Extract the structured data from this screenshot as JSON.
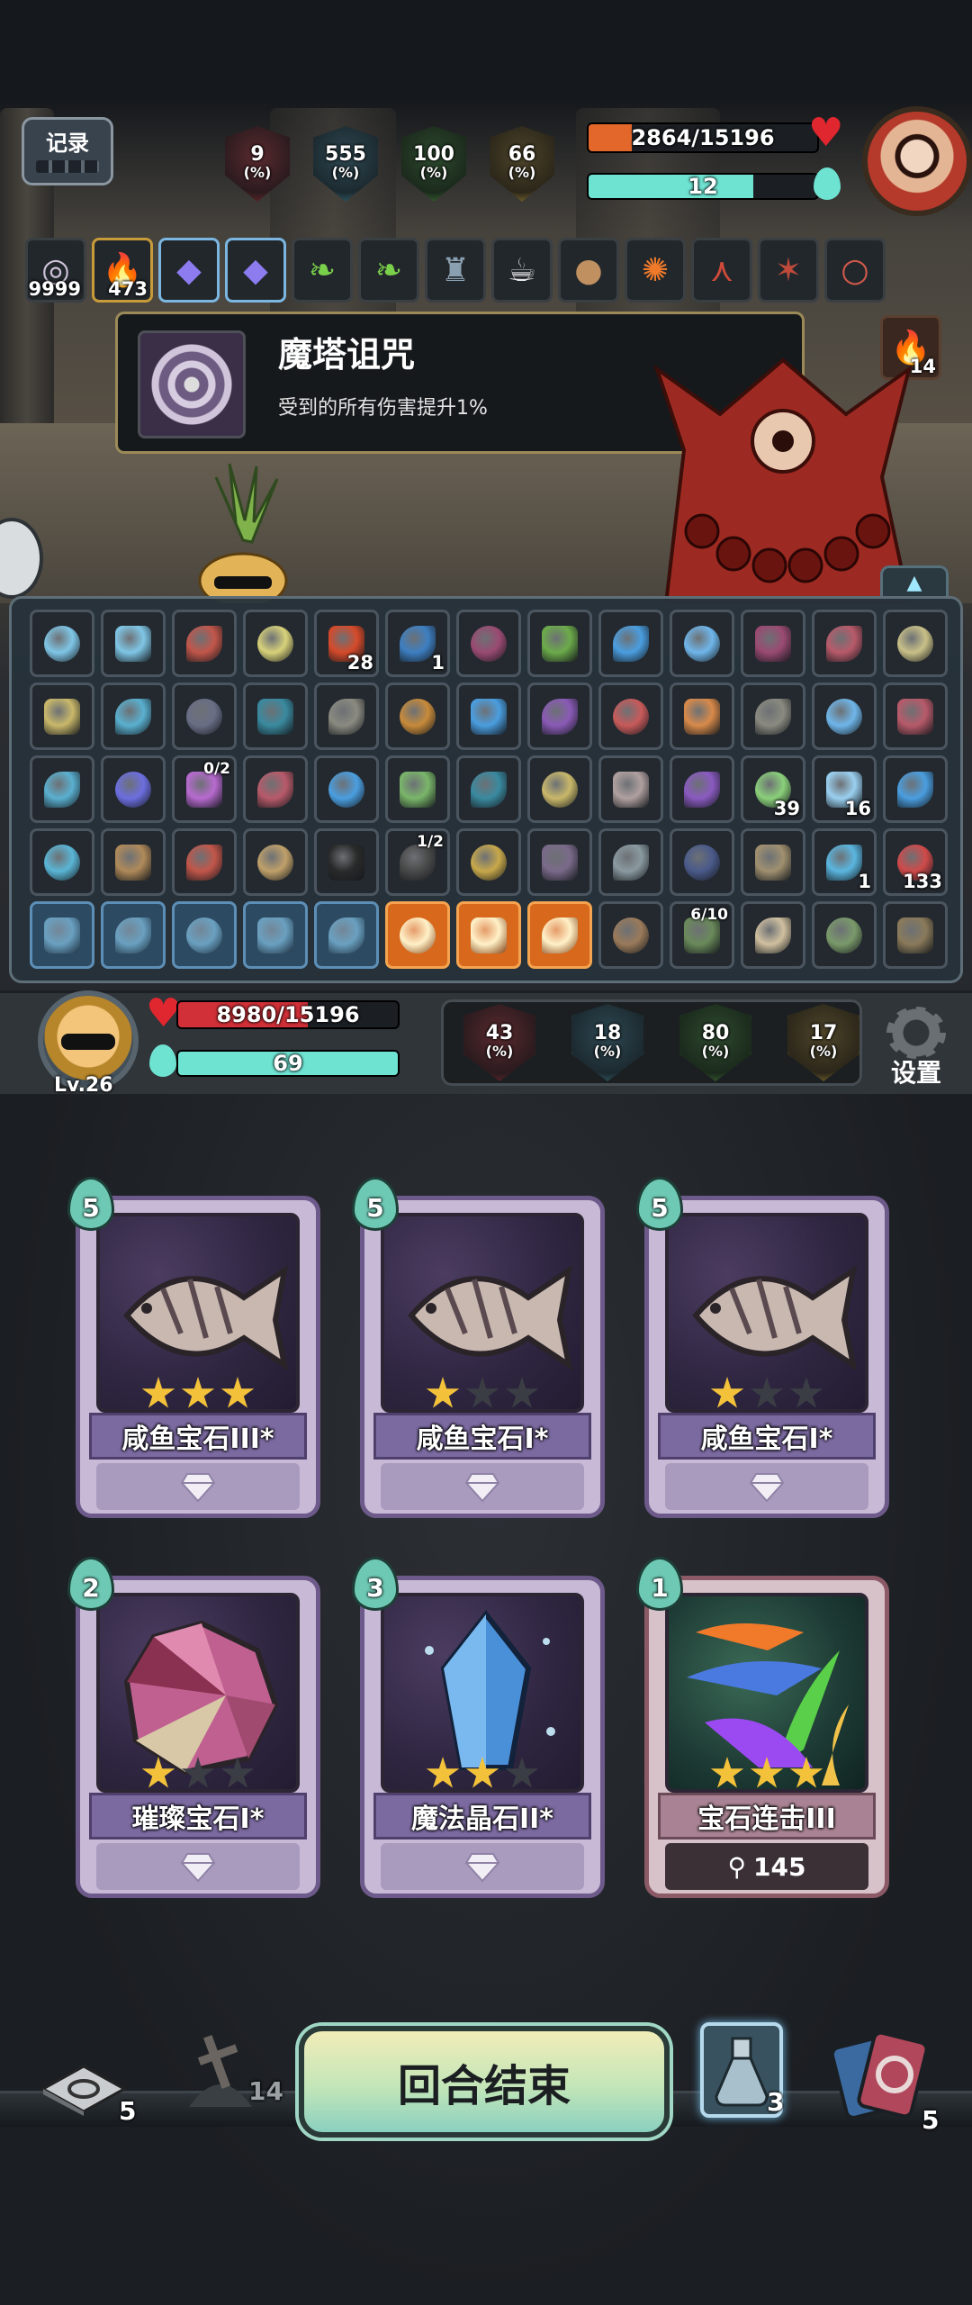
{
  "record_label": "记录",
  "enemy": {
    "stats": [
      {
        "value": "9",
        "unit": "(%)",
        "style": "sh-red"
      },
      {
        "value": "555",
        "unit": "(%)",
        "style": "sh-blue"
      },
      {
        "value": "100",
        "unit": "(%)",
        "style": "sh-green"
      },
      {
        "value": "66",
        "unit": "(%)",
        "style": "sh-gold"
      }
    ],
    "hp_text": "2864/15196",
    "hp_fraction": 0.188,
    "energy_text": "12",
    "energy_fraction": 0.72,
    "fire_count": "14"
  },
  "buffs": [
    {
      "icon": "spiral-curse-icon",
      "glyph": "◎",
      "count": "9999",
      "border": "normal"
    },
    {
      "icon": "golden-fire-icon",
      "glyph": "🔥",
      "count": "473",
      "border": "gold"
    },
    {
      "icon": "purple-gem-icon",
      "glyph": "◆",
      "count": "",
      "border": "blue"
    },
    {
      "icon": "purple-gem-icon",
      "glyph": "◆",
      "count": "",
      "border": "blue"
    },
    {
      "icon": "green-leaf-icon",
      "glyph": "❧",
      "count": "",
      "border": "normal"
    },
    {
      "icon": "green-leaf-icon",
      "glyph": "❧",
      "count": "",
      "border": "normal"
    },
    {
      "icon": "armor-figure-icon",
      "glyph": "♜",
      "count": "",
      "border": "normal"
    },
    {
      "icon": "teacup-icon",
      "glyph": "☕",
      "count": "",
      "border": "normal"
    },
    {
      "icon": "cookie-icon",
      "glyph": "●",
      "count": "",
      "border": "normal"
    },
    {
      "icon": "flame-dragon-icon",
      "glyph": "✺",
      "count": "",
      "border": "normal"
    },
    {
      "icon": "red-branch-icon",
      "glyph": "⋏",
      "count": "",
      "border": "normal"
    },
    {
      "icon": "red-claw-icon",
      "glyph": "✶",
      "count": "",
      "border": "normal"
    },
    {
      "icon": "bead-necklace-icon",
      "glyph": "○",
      "count": "",
      "border": "normal"
    }
  ],
  "tooltip": {
    "title": "魔塔诅咒",
    "description": "受到的所有伤害提升1%"
  },
  "relics": [
    {
      "icon": "blue-swirl-icon",
      "c": "#7fc6e6",
      "count": "",
      "frac": "",
      "style": ""
    },
    {
      "icon": "blue-swirl-icon",
      "c": "#7fc6e6",
      "count": "",
      "frac": "",
      "style": ""
    },
    {
      "icon": "red-beast-icon",
      "c": "#c2564a",
      "count": "",
      "frac": "",
      "style": ""
    },
    {
      "icon": "yellow-stone-icon",
      "c": "#d8d27a",
      "count": "",
      "frac": "",
      "style": ""
    },
    {
      "icon": "red-flame-icon",
      "c": "#d64a2a",
      "count": "28",
      "frac": "",
      "style": ""
    },
    {
      "icon": "blue-shield-icon",
      "c": "#3d7fc2",
      "count": "1",
      "frac": "",
      "style": ""
    },
    {
      "icon": "demon-mask-icon",
      "c": "#9a4a72",
      "count": "",
      "frac": "",
      "style": ""
    },
    {
      "icon": "green-ring-icon",
      "c": "#6cab4a",
      "count": "",
      "frac": "",
      "style": ""
    },
    {
      "icon": "blue-eye-icon",
      "c": "#4a9ee0",
      "count": "",
      "frac": "",
      "style": ""
    },
    {
      "icon": "blue-crystal-icon",
      "c": "#6fb6ea",
      "count": "",
      "frac": "",
      "style": ""
    },
    {
      "icon": "demon-mask-icon",
      "c": "#9a4a72",
      "count": "",
      "frac": "",
      "style": ""
    },
    {
      "icon": "crossed-blades-icon",
      "c": "#b85a6a",
      "count": "",
      "frac": "",
      "style": ""
    },
    {
      "icon": "sun-stone-icon",
      "c": "#c9c088",
      "count": "",
      "frac": "",
      "style": ""
    },
    {
      "icon": "sun-stone-icon",
      "c": "#c9b86a",
      "count": "",
      "frac": "",
      "style": ""
    },
    {
      "icon": "blue-vortex-icon",
      "c": "#5ab0d0",
      "count": "",
      "frac": "",
      "style": ""
    },
    {
      "icon": "dark-hex-icon",
      "c": "#6a6e86",
      "count": "",
      "frac": "",
      "style": ""
    },
    {
      "icon": "teal-hex-icon",
      "c": "#3a8aa0",
      "count": "",
      "frac": "",
      "style": ""
    },
    {
      "icon": "grey-gear-icon",
      "c": "#8a8a80",
      "count": "",
      "frac": "",
      "style": ""
    },
    {
      "icon": "amber-crystal-icon",
      "c": "#c88a3a",
      "count": "",
      "frac": "",
      "style": ""
    },
    {
      "icon": "blue-eye-icon",
      "c": "#4a9ee0",
      "count": "",
      "frac": "",
      "style": ""
    },
    {
      "icon": "purple-orb-icon",
      "c": "#8a5ab6",
      "count": "",
      "frac": "",
      "style": ""
    },
    {
      "icon": "red-sword-icon",
      "c": "#c85a5a",
      "count": "",
      "frac": "",
      "style": ""
    },
    {
      "icon": "orange-crystal-icon",
      "c": "#d88a4a",
      "count": "",
      "frac": "",
      "style": ""
    },
    {
      "icon": "grey-gear-icon",
      "c": "#8a8a80",
      "count": "",
      "frac": "",
      "style": ""
    },
    {
      "icon": "blue-crystal-icon",
      "c": "#6fb6ea",
      "count": "",
      "frac": "",
      "style": ""
    },
    {
      "icon": "crossed-blades-icon",
      "c": "#b85a6a",
      "count": "",
      "frac": "",
      "style": ""
    },
    {
      "icon": "blue-vortex-icon",
      "c": "#5ab0d0",
      "count": "",
      "frac": "",
      "style": ""
    },
    {
      "icon": "purple-gem-icon",
      "c": "#6c6ee0",
      "count": "",
      "frac": "",
      "style": ""
    },
    {
      "icon": "pink-card-icon",
      "c": "#b86ad0",
      "count": "",
      "frac": "0/2",
      "style": ""
    },
    {
      "icon": "crossed-blades-icon",
      "c": "#b85a6a",
      "count": "",
      "frac": "",
      "style": ""
    },
    {
      "icon": "blue-eye-icon",
      "c": "#4a9ee0",
      "count": "",
      "frac": "",
      "style": ""
    },
    {
      "icon": "green-crystal-icon",
      "c": "#7ab66a",
      "count": "",
      "frac": "",
      "style": ""
    },
    {
      "icon": "teal-hex-icon",
      "c": "#3a8aa0",
      "count": "",
      "frac": "",
      "style": ""
    },
    {
      "icon": "sun-stone-icon",
      "c": "#c9b86a",
      "count": "",
      "frac": "",
      "style": ""
    },
    {
      "icon": "fish-icon",
      "c": "#b0a0a0",
      "count": "",
      "frac": "",
      "style": ""
    },
    {
      "icon": "purple-stone-icon",
      "c": "#8a5ac0",
      "count": "",
      "frac": "",
      "style": ""
    },
    {
      "icon": "green-dash-icon",
      "c": "#8ad07a",
      "count": "39",
      "frac": "",
      "style": ""
    },
    {
      "icon": "lightning-icon",
      "c": "#9ad0f0",
      "count": "16",
      "frac": "",
      "style": ""
    },
    {
      "icon": "blue-eye-icon",
      "c": "#4a9ee0",
      "count": "",
      "frac": "",
      "style": ""
    },
    {
      "icon": "blue-rock-icon",
      "c": "#5ab6d6",
      "count": "",
      "frac": "",
      "style": ""
    },
    {
      "icon": "cookie-icon",
      "c": "#b08a5a",
      "count": "",
      "frac": "",
      "style": ""
    },
    {
      "icon": "red-beast-icon",
      "c": "#c2564a",
      "count": "",
      "frac": "",
      "style": ""
    },
    {
      "icon": "helmet-icon",
      "c": "#c0a06a",
      "count": "",
      "frac": "",
      "style": ""
    },
    {
      "icon": "black-crown-icon",
      "c": "#2a2a2a",
      "count": "",
      "frac": "",
      "style": ""
    },
    {
      "icon": "black-gauntlet-icon",
      "c": "#4a4a4a",
      "count": "",
      "frac": "1/2",
      "style": ""
    },
    {
      "icon": "golden-watch-icon",
      "c": "#c8a84a",
      "count": "",
      "frac": "",
      "style": ""
    },
    {
      "icon": "glove-icon",
      "c": "#7a6a8a",
      "count": "",
      "frac": "",
      "style": ""
    },
    {
      "icon": "hammer-icon",
      "c": "#8a9aa0",
      "count": "",
      "frac": "",
      "style": ""
    },
    {
      "icon": "dark-mask-icon",
      "c": "#4a5a8a",
      "count": "",
      "frac": "",
      "style": ""
    },
    {
      "icon": "scales-icon",
      "c": "#a09070",
      "count": "",
      "frac": "",
      "style": ""
    },
    {
      "icon": "crescent-icon",
      "c": "#5ab6e0",
      "count": "1",
      "frac": "",
      "style": ""
    },
    {
      "icon": "red-swirl-icon",
      "c": "#d04a4a",
      "count": "133",
      "frac": "",
      "style": ""
    },
    {
      "icon": "target-frame-icon",
      "c": "#6aa0c0",
      "count": "",
      "frac": "",
      "style": "blueb"
    },
    {
      "icon": "rune-frame-icon",
      "c": "#6aa0c0",
      "count": "",
      "frac": "",
      "style": "blueb"
    },
    {
      "icon": "rose-frame-icon",
      "c": "#6aa0c0",
      "count": "",
      "frac": "",
      "style": "blueb"
    },
    {
      "icon": "dancer-frame-icon",
      "c": "#6aa0c0",
      "count": "",
      "frac": "",
      "style": "blueb"
    },
    {
      "icon": "flower-frame-icon",
      "c": "#6aa0c0",
      "count": "",
      "frac": "",
      "style": "blueb"
    },
    {
      "icon": "orange-rune-icon",
      "c": "#fff1c8",
      "count": "",
      "frac": "",
      "style": "orange"
    },
    {
      "icon": "orange-flame-icon",
      "c": "#fff1c8",
      "count": "",
      "frac": "",
      "style": "orange"
    },
    {
      "icon": "orange-hat-icon",
      "c": "#fff1c8",
      "count": "",
      "frac": "",
      "style": "orange"
    },
    {
      "icon": "wizard-icon",
      "c": "#9a7a5a",
      "count": "",
      "frac": "",
      "style": ""
    },
    {
      "icon": "turtle-icon",
      "c": "#6a8a5a",
      "count": "",
      "frac": "6/10",
      "style": ""
    },
    {
      "icon": "claw-icon",
      "c": "#d0c0a0",
      "count": "",
      "frac": "",
      "style": ""
    },
    {
      "icon": "beetle-icon",
      "c": "#7a9a6a",
      "count": "",
      "frac": "",
      "style": ""
    },
    {
      "icon": "dagger-icon",
      "c": "#8a7a5a",
      "count": "",
      "frac": "",
      "style": ""
    }
  ],
  "player": {
    "level": "Lv.26",
    "hp_text": "8980/15196",
    "hp_fraction": 0.591,
    "energy_text": "69",
    "energy_fraction": 1.0,
    "stats": [
      {
        "value": "43",
        "unit": "(%)",
        "style": "sh-red"
      },
      {
        "value": "18",
        "unit": "(%)",
        "style": "sh-blue"
      },
      {
        "value": "80",
        "unit": "(%)",
        "style": "sh-green"
      },
      {
        "value": "17",
        "unit": "(%)",
        "style": "sh-gold"
      }
    ],
    "settings_label": "设置"
  },
  "cards": [
    {
      "name": "咸鱼宝石III*",
      "cost": "5",
      "stars": 3,
      "art": "fish",
      "footer": "",
      "red": false
    },
    {
      "name": "咸鱼宝石I*",
      "cost": "5",
      "stars": 1,
      "art": "fish",
      "footer": "",
      "red": false
    },
    {
      "name": "咸鱼宝石I*",
      "cost": "5",
      "stars": 1,
      "art": "fish",
      "footer": "",
      "red": false
    },
    {
      "name": "璀璨宝石I*",
      "cost": "2",
      "stars": 1,
      "art": "gem",
      "footer": "",
      "red": false
    },
    {
      "name": "魔法晶石II*",
      "cost": "3",
      "stars": 2,
      "art": "crystal",
      "footer": "",
      "red": false
    },
    {
      "name": "宝石连击III",
      "cost": "1",
      "stars": 3,
      "art": "comet",
      "footer": "145",
      "red": true
    }
  ],
  "bottom": {
    "draw_pile": "5",
    "discard_pile": "14",
    "potion_count": "3",
    "exhaust_pile": "5",
    "end_turn_label": "回合结束"
  }
}
